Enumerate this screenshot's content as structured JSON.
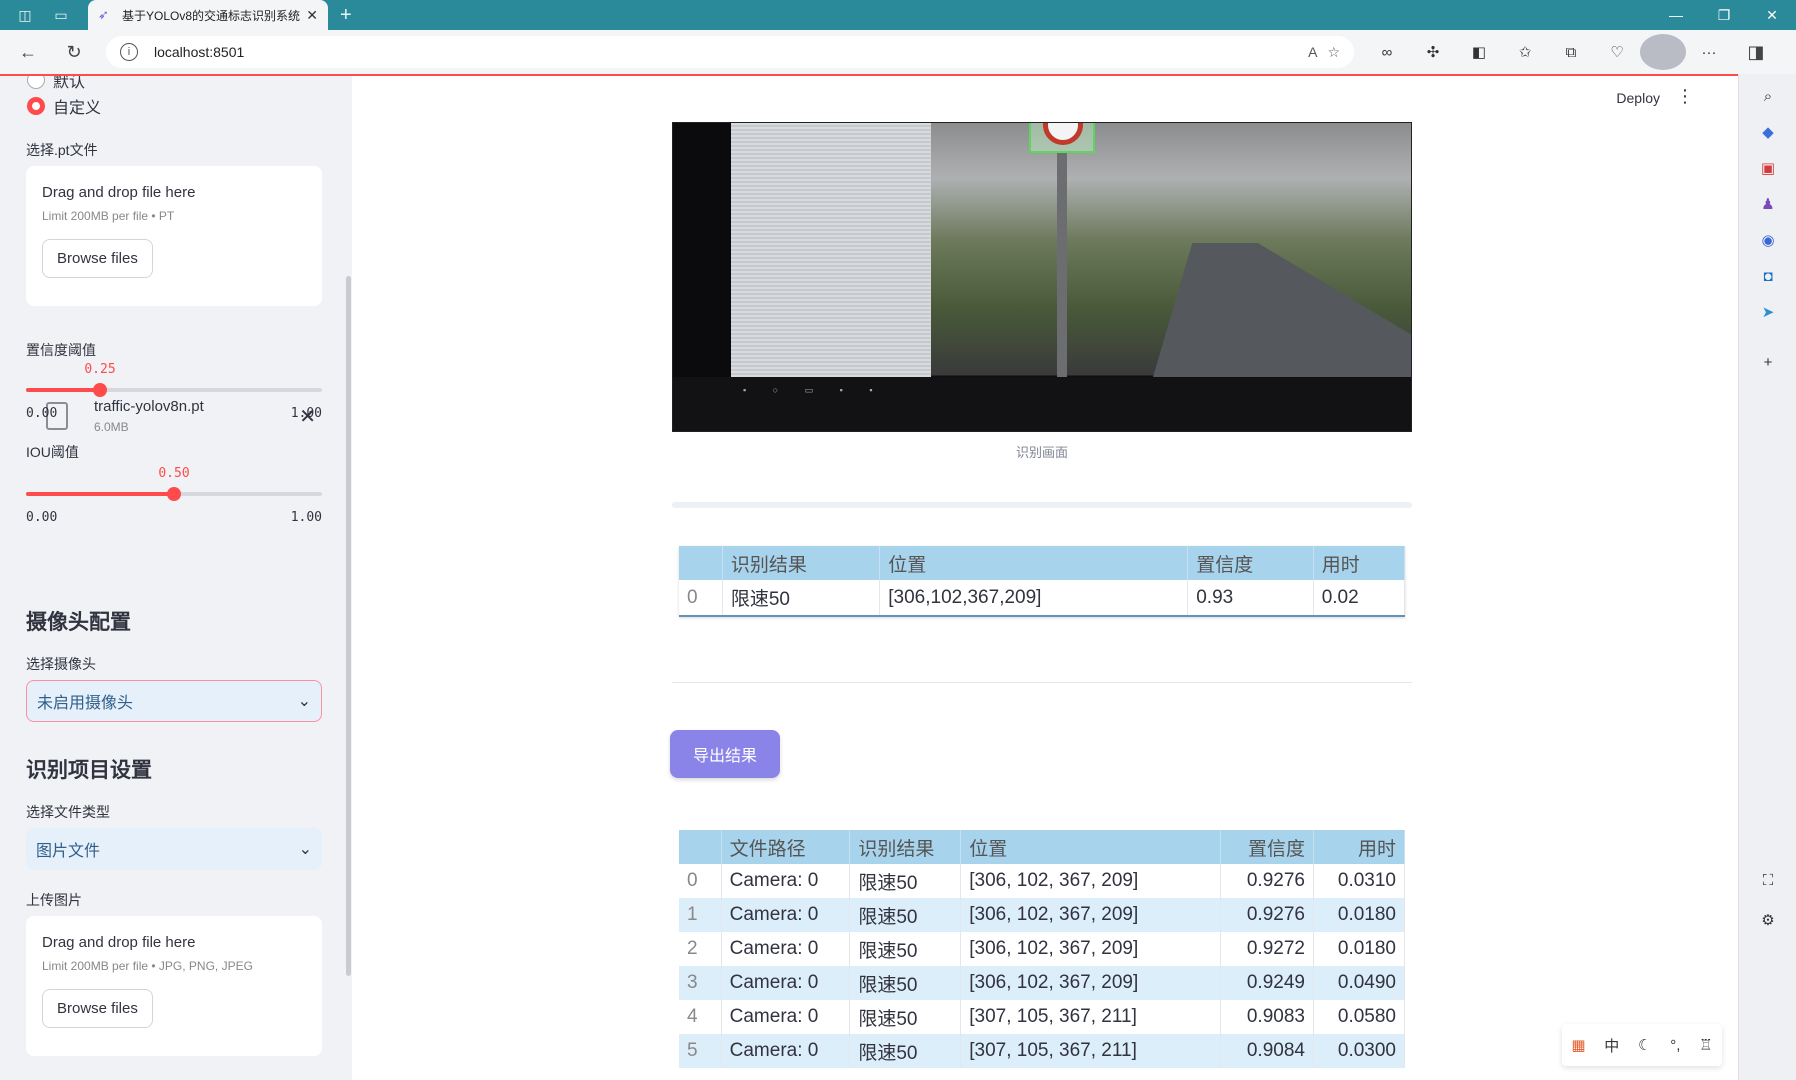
{
  "browser": {
    "tab_title": "基于YOLOv8的交通标志识别系统",
    "url": "localhost:8501",
    "reader_label": "A",
    "win_min": "—",
    "win_restore": "❐",
    "win_close": "✕"
  },
  "sidebar": {
    "radio_default": "默认",
    "radio_custom": "自定义",
    "pt_label": "选择.pt文件",
    "pt_uploader": {
      "heading": "Drag and drop file here",
      "sub": "Limit 200MB per file • PT",
      "button": "Browse files"
    },
    "file": {
      "name": "traffic-yolov8n.pt",
      "size": "6.0MB"
    },
    "conf": {
      "label": "置信度阈值",
      "value": "0.25",
      "fraction": 0.25,
      "min": "0.00",
      "max": "1.00"
    },
    "iou": {
      "label": "IOU阈值",
      "value": "0.50",
      "fraction": 0.5,
      "min": "0.00",
      "max": "1.00"
    },
    "camera_header": "摄像头配置",
    "camera_label": "选择摄像头",
    "camera_value": "未启用摄像头",
    "task_header": "识别项目设置",
    "filetype_label": "选择文件类型",
    "filetype_value": "图片文件",
    "upload_label": "上传图片",
    "img_uploader": {
      "heading": "Drag and drop file here",
      "sub": "Limit 200MB per file • JPG, PNG, JPEG",
      "button": "Browse files"
    }
  },
  "main": {
    "deploy": "Deploy",
    "caption": "识别画面",
    "export_button": "导出结果",
    "result_table": {
      "headers": [
        "",
        "识别结果",
        "位置",
        "置信度",
        "用时"
      ],
      "rows": [
        [
          "0",
          "限速50",
          "[306,102,367,209]",
          "0.93",
          "0.02"
        ]
      ]
    },
    "log_table": {
      "headers": [
        "",
        "文件路径",
        "识别结果",
        "位置",
        "置信度",
        "用时"
      ],
      "rows": [
        [
          "0",
          "Camera: 0",
          "限速50",
          "[306, 102, 367, 209]",
          "0.9276",
          "0.0310"
        ],
        [
          "1",
          "Camera: 0",
          "限速50",
          "[306, 102, 367, 209]",
          "0.9276",
          "0.0180"
        ],
        [
          "2",
          "Camera: 0",
          "限速50",
          "[306, 102, 367, 209]",
          "0.9272",
          "0.0180"
        ],
        [
          "3",
          "Camera: 0",
          "限速50",
          "[306, 102, 367, 209]",
          "0.9249",
          "0.0490"
        ],
        [
          "4",
          "Camera: 0",
          "限速50",
          "[307, 105, 367, 211]",
          "0.9083",
          "0.0580"
        ],
        [
          "5",
          "Camera: 0",
          "限速50",
          "[307, 105, 367, 211]",
          "0.9084",
          "0.0300"
        ]
      ]
    }
  },
  "ime": {
    "lang": "中"
  },
  "colors": {
    "accent": "#ff4b4b",
    "header_blue": "#a7d4ec",
    "button_purple": "#8b84e8",
    "chrome_teal": "#2b8a9a"
  }
}
